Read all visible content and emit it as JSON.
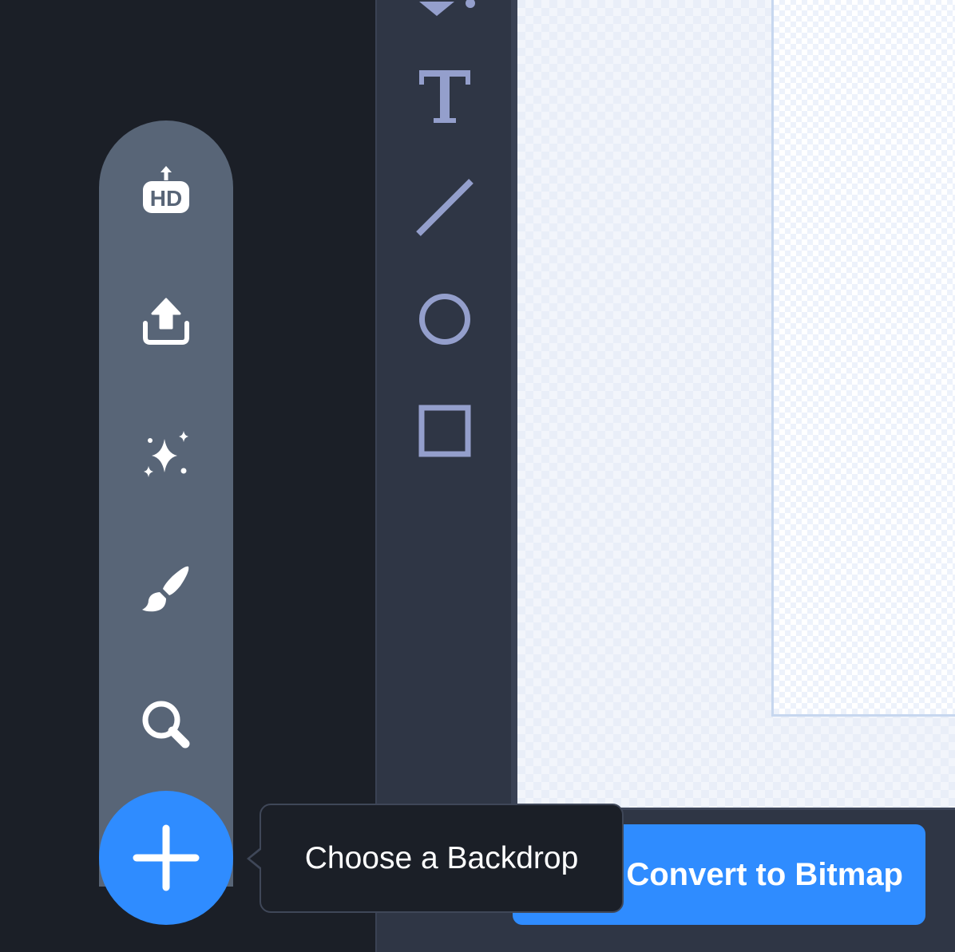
{
  "tooltip": {
    "text": "Choose a Backdrop"
  },
  "bottom_bar": {
    "convert_label": "Convert to Bitmap"
  },
  "backdrop_menu": {
    "items": [
      {
        "icon": "hd-upload-icon"
      },
      {
        "icon": "upload-icon"
      },
      {
        "icon": "sparkles-icon"
      },
      {
        "icon": "paint-brush-icon"
      },
      {
        "icon": "search-icon"
      }
    ],
    "main_icon": "plus-icon"
  },
  "tools": [
    {
      "icon": "fill-icon"
    },
    {
      "icon": "text-icon"
    },
    {
      "icon": "line-icon"
    },
    {
      "icon": "circle-icon"
    },
    {
      "icon": "rectangle-icon"
    }
  ],
  "colors": {
    "accent": "#2f8cff",
    "tool_icon": "#949fcc",
    "menu_bg": "#586577",
    "panel_bg": "#2f3645",
    "stage_bg": "#1b1f27"
  }
}
